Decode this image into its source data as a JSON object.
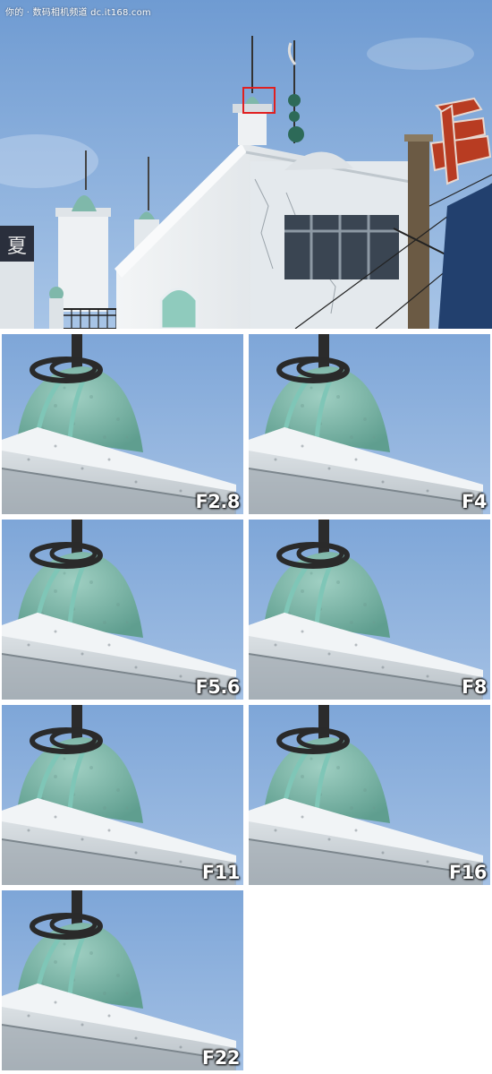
{
  "watermark": "你的 · 数码相机频道 dc.it168.com",
  "building_sign_char": "夏",
  "colors": {
    "sky_top": "#7ea6d8",
    "sky_bottom": "#a9c6e8",
    "dome": "#7fb8aa",
    "wall": "#e9eef2",
    "crop_box": "#e02020"
  },
  "apertures": [
    {
      "label": "F2.8"
    },
    {
      "label": "F4"
    },
    {
      "label": "F5.6"
    },
    {
      "label": "F8"
    },
    {
      "label": "F11"
    },
    {
      "label": "F16"
    },
    {
      "label": "F22"
    }
  ]
}
